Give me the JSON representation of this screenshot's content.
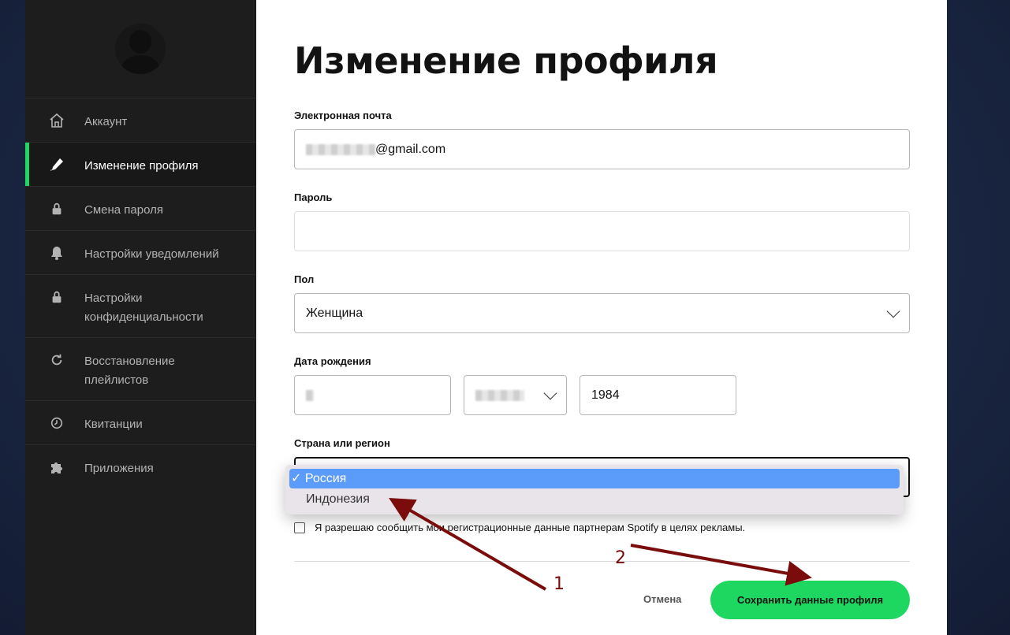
{
  "sidebar": {
    "items": [
      {
        "label": "Аккаунт",
        "icon": "home-icon"
      },
      {
        "label": "Изменение профиля",
        "icon": "pen-icon",
        "active": true
      },
      {
        "label": "Смена пароля",
        "icon": "lock-icon"
      },
      {
        "label": "Настройки уведомлений",
        "icon": "bell-icon"
      },
      {
        "label": "Настройки конфиденциальности",
        "icon": "lock-icon"
      },
      {
        "label": "Восстановление плейлистов",
        "icon": "refresh-icon"
      },
      {
        "label": "Квитанции",
        "icon": "clock-icon"
      },
      {
        "label": "Приложения",
        "icon": "puzzle-icon"
      }
    ]
  },
  "main": {
    "title": "Изменение профиля",
    "email": {
      "label": "Электронная почта",
      "value": "@gmail.com"
    },
    "password": {
      "label": "Пароль",
      "value": ""
    },
    "gender": {
      "label": "Пол",
      "value": "Женщина"
    },
    "birthdate": {
      "label": "Дата рождения",
      "year": "1984"
    },
    "country": {
      "label": "Страна или регион",
      "options": [
        {
          "label": "Россия",
          "selected": true
        },
        {
          "label": "Индонезия",
          "selected": false
        }
      ]
    },
    "consent": "Я разрешаю сообщить мои регистрационные данные партнерам Spotify в целях рекламы.",
    "cancel": "Отмена",
    "save": "Сохранить данные профиля"
  },
  "annotations": {
    "arrow1": "1",
    "arrow2": "2",
    "color": "#7a0c0c"
  },
  "colors": {
    "accent": "#1ed760",
    "sidebar_bg": "#1d1d1d",
    "selection": "#5b9bf9"
  }
}
